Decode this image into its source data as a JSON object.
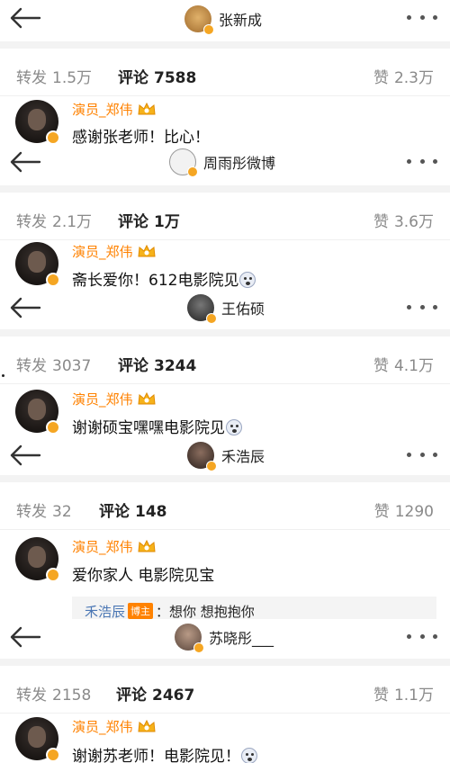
{
  "icons": {
    "back": "back-arrow-icon",
    "more": "more-dots-icon",
    "verified": "verified-badge-icon",
    "crown": "vip-crown-icon",
    "emoji": "emoji-icon"
  },
  "colors": {
    "accent": "#ff8200",
    "name": "#ff8200",
    "reply_name": "#4b77b4",
    "badge": "#f5a623"
  },
  "screens": [
    {
      "header_user": "张新成",
      "tabs": {
        "repost_label": "转发",
        "repost_count": "1.5万",
        "comment_label": "评论",
        "comment_count": "7588",
        "like_label": "赞",
        "like_count": "2.3万"
      },
      "comment": {
        "author": "演员_郑伟",
        "text": "感谢张老师！比心！"
      }
    },
    {
      "header_user": "周雨彤微博",
      "tabs": {
        "repost_label": "转发",
        "repost_count": "2.1万",
        "comment_label": "评论",
        "comment_count": "1万",
        "like_label": "赞",
        "like_count": "3.6万"
      },
      "comment": {
        "author": "演员_郑伟",
        "text": "斋长爱你！612电影院见"
      }
    },
    {
      "header_user": "王佑硕",
      "tabs": {
        "repost_label": "转发",
        "repost_count": "3037",
        "comment_label": "评论",
        "comment_count": "3244",
        "like_label": "赞",
        "like_count": "4.1万"
      },
      "comment": {
        "author": "演员_郑伟",
        "text": "谢谢硕宝嘿嘿电影院见"
      }
    },
    {
      "header_user": "禾浩辰",
      "tabs": {
        "repost_label": "转发",
        "repost_count": "32",
        "comment_label": "评论",
        "comment_count": "148",
        "like_label": "赞",
        "like_count": "1290"
      },
      "comment": {
        "author": "演员_郑伟",
        "text": "爱你家人 电影院见宝"
      },
      "reply": {
        "author": "禾浩辰",
        "badge": "博主",
        "text": "：想你 想抱抱你"
      }
    },
    {
      "header_user": "苏晓彤___",
      "tabs": {
        "repost_label": "转发",
        "repost_count": "2158",
        "comment_label": "评论",
        "comment_count": "2467",
        "like_label": "赞",
        "like_count": "1.1万"
      },
      "comment": {
        "author": "演员_郑伟",
        "text": "谢谢苏老师！电影院见！"
      }
    }
  ]
}
